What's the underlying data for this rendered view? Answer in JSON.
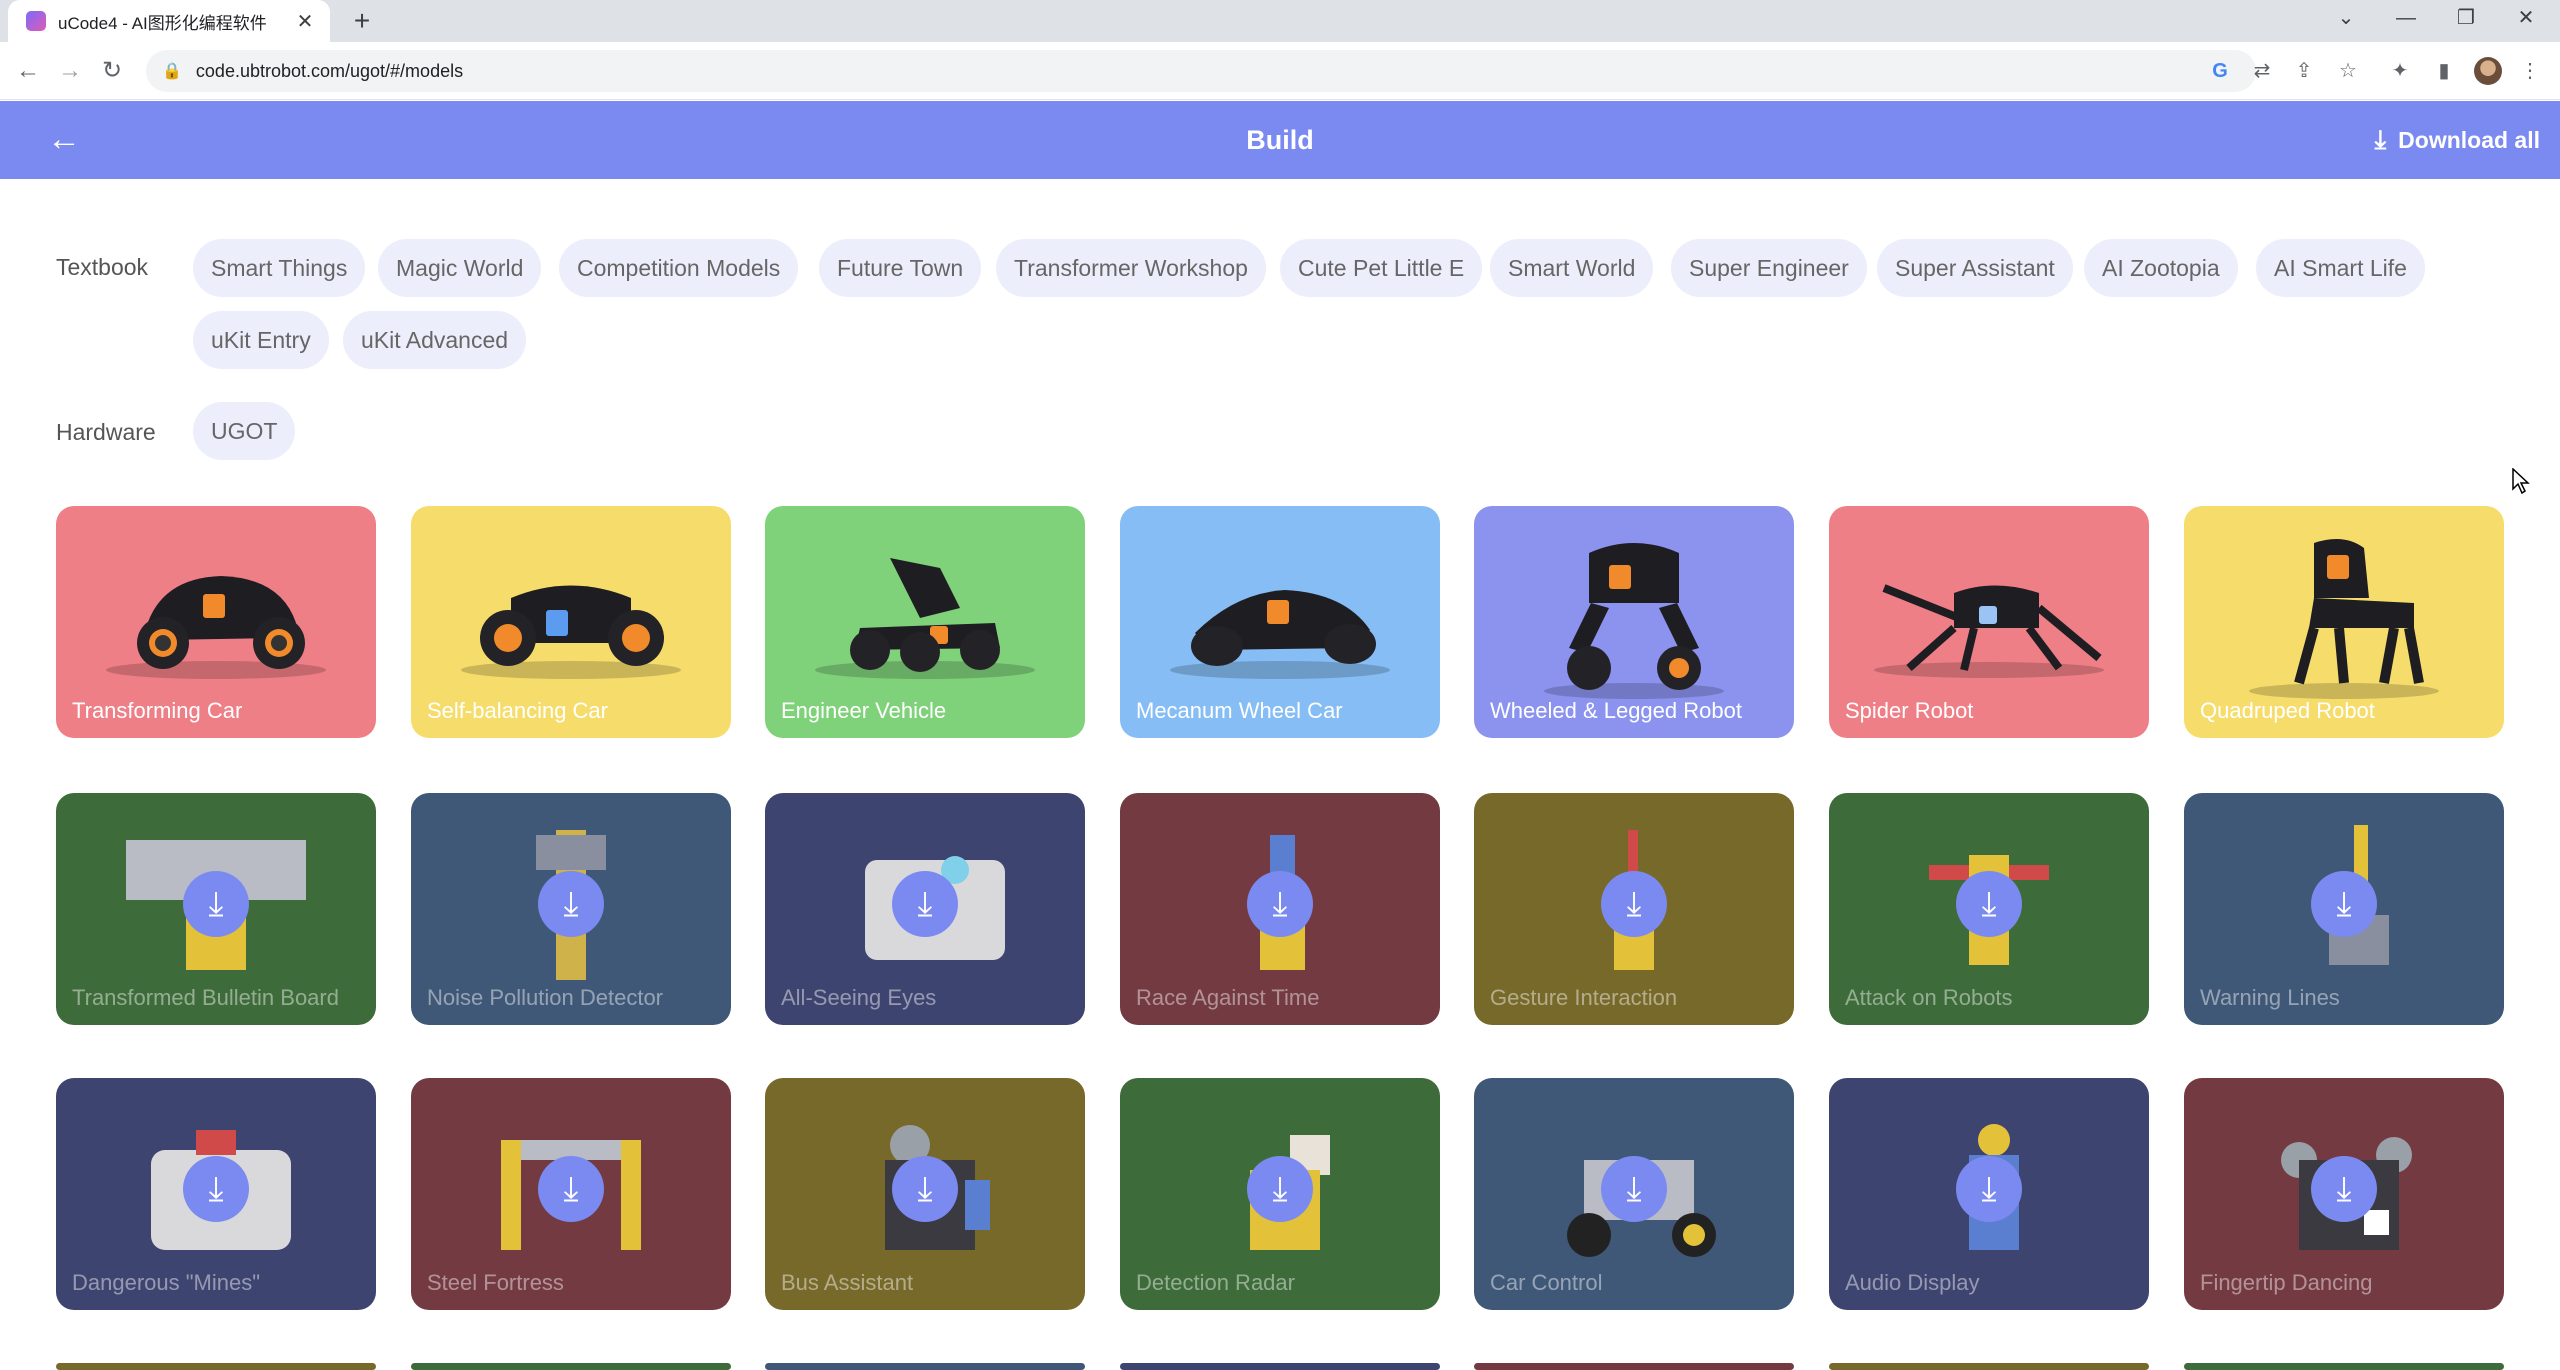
{
  "browser": {
    "tab_title": "uCode4 - AI图形化编程软件",
    "tab_close": "✕",
    "new_tab": "+",
    "url": "code.ubtrobot.com/ugot/#/models",
    "controls": {
      "chevron": "⌄",
      "minimize": "—",
      "restore": "❐",
      "close": "✕"
    }
  },
  "header": {
    "title": "Build",
    "back": "←",
    "download_all": "Download all",
    "download_icon": "⤓"
  },
  "filters": {
    "textbook_label": "Textbook",
    "textbooks": [
      "Smart Things",
      "Magic World",
      "Competition Models",
      "Future Town",
      "Transformer Workshop",
      "Cute Pet Little E",
      "Smart World",
      "Super Engineer",
      "Super Assistant",
      "AI Zootopia",
      "AI Smart Life",
      "uKit Entry",
      "uKit Advanced"
    ],
    "hardware_label": "Hardware",
    "hardware": [
      "UGOT"
    ]
  },
  "models": {
    "row1": [
      {
        "name": "Transforming Car",
        "bg": "#ef7f86"
      },
      {
        "name": "Self-balancing Car",
        "bg": "#f6dd6b"
      },
      {
        "name": "Engineer Vehicle",
        "bg": "#7fd17a"
      },
      {
        "name": "Mecanum Wheel Car",
        "bg": "#86bdf5"
      },
      {
        "name": "Wheeled & Legged Robot",
        "bg": "#8b93ee"
      },
      {
        "name": "Spider Robot",
        "bg": "#ef7f86"
      },
      {
        "name": "Quadruped Robot",
        "bg": "#f6dd6b"
      }
    ],
    "row2": [
      {
        "name": "Transformed Bulletin Board",
        "bg": "#3d6b3a"
      },
      {
        "name": "Noise Pollution Detector",
        "bg": "#3f5878"
      },
      {
        "name": "All-Seeing Eyes",
        "bg": "#3e4470"
      },
      {
        "name": "Race Against Time",
        "bg": "#733a42"
      },
      {
        "name": "Gesture Interaction",
        "bg": "#77692a"
      },
      {
        "name": "Attack on Robots",
        "bg": "#3d6b3a"
      },
      {
        "name": "Warning Lines",
        "bg": "#3f5878"
      }
    ],
    "row3": [
      {
        "name": "Dangerous \"Mines\"",
        "bg": "#3e4470"
      },
      {
        "name": "Steel Fortress",
        "bg": "#733a42"
      },
      {
        "name": "Bus Assistant",
        "bg": "#77692a"
      },
      {
        "name": "Detection Radar",
        "bg": "#3d6b3a"
      },
      {
        "name": "Car Control",
        "bg": "#3f5878"
      },
      {
        "name": "Audio Display",
        "bg": "#3e4470"
      },
      {
        "name": "Fingertip Dancing",
        "bg": "#733a42"
      }
    ],
    "row4_bgs": [
      "#77692a",
      "#3d6b3a",
      "#3f5878",
      "#3e4470",
      "#733a42",
      "#77692a",
      "#3d6b3a"
    ]
  }
}
